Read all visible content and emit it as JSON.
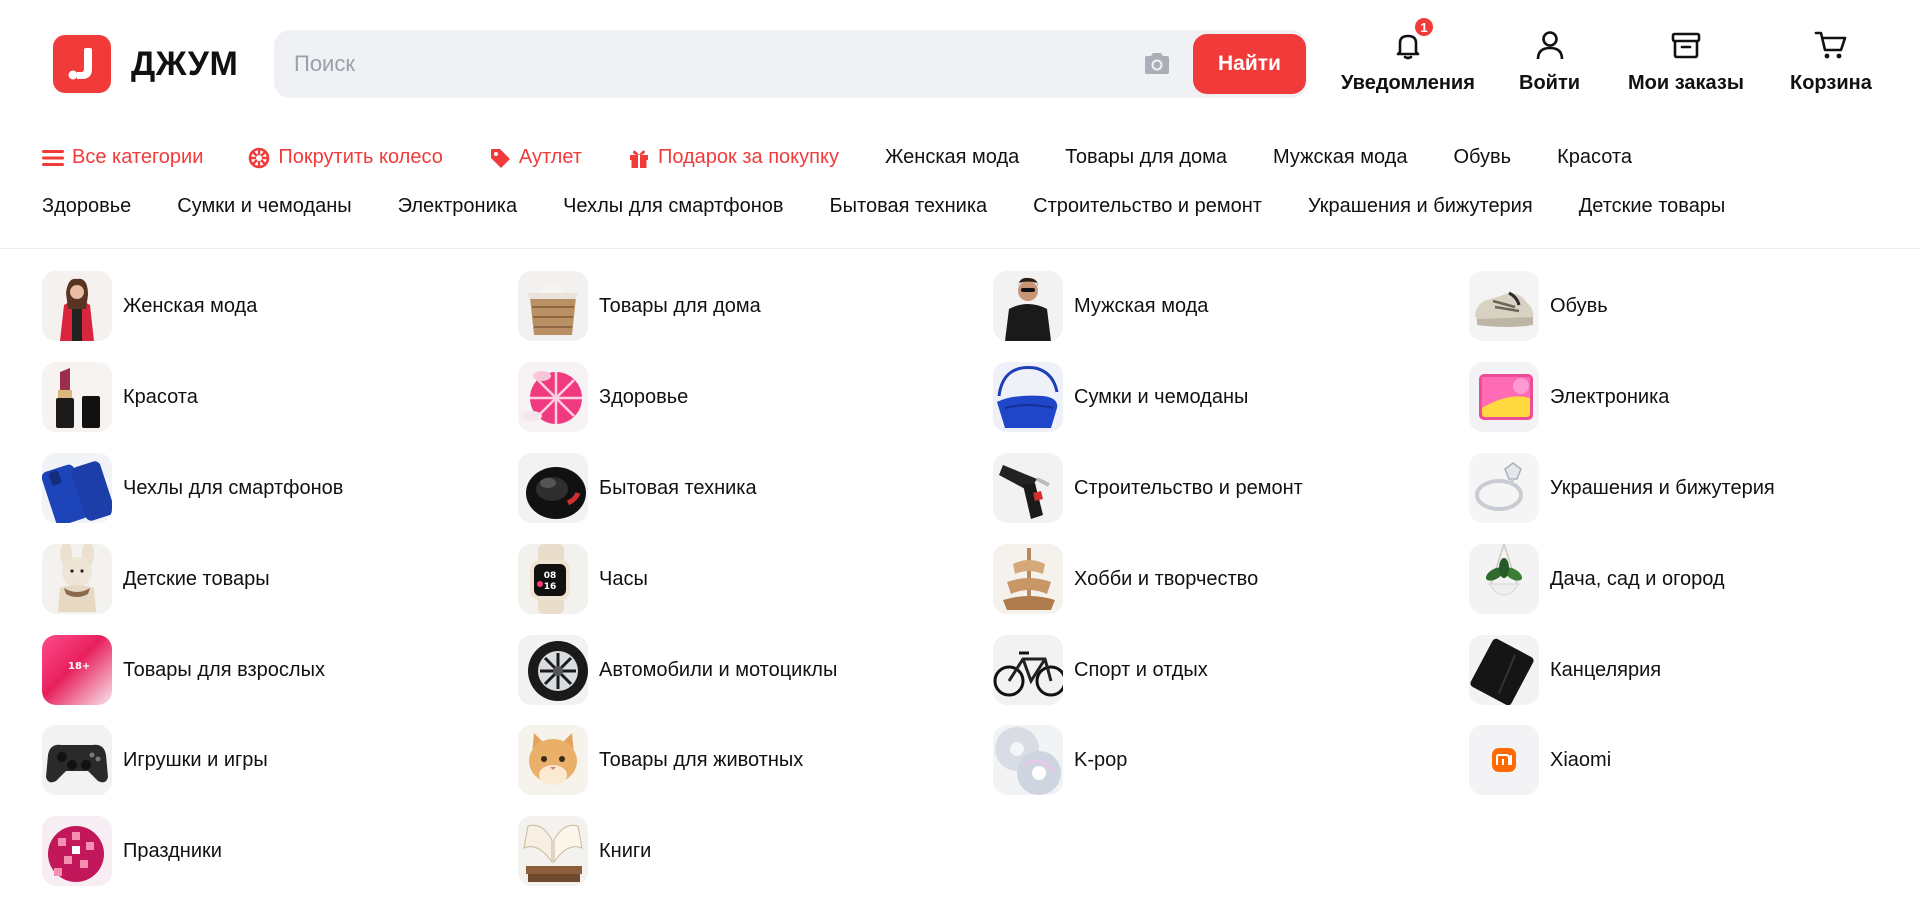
{
  "brand": {
    "name": "ДЖУМ",
    "accent": "#f13b3b"
  },
  "search": {
    "placeholder": "Поиск",
    "value": "",
    "button_label": "Найти"
  },
  "header_actions": {
    "notifications": {
      "label": "Уведомления",
      "badge": "1",
      "icon": "bell-icon"
    },
    "login": {
      "label": "Войти",
      "icon": "user-icon"
    },
    "orders": {
      "label": "Мои заказы",
      "icon": "archive-box-icon"
    },
    "cart": {
      "label": "Корзина",
      "icon": "cart-icon"
    }
  },
  "nav": {
    "all_categories": "Все категории",
    "spin_wheel": "Покрутить колесо",
    "outlet": "Аутлет",
    "gift": "Подарок за покупку",
    "row1": [
      "Женская мода",
      "Товары для дома",
      "Мужская мода",
      "Обувь",
      "Красота"
    ],
    "row2": [
      "Здоровье",
      "Сумки и чемоданы",
      "Электроника",
      "Чехлы для смартфонов",
      "Бытовая техника",
      "Строительство и ремонт",
      "Украшения и бижутерия",
      "Детские товары"
    ]
  },
  "categories": [
    {
      "label": "Женская мода",
      "icon": "woman-fashion-thumb"
    },
    {
      "label": "Товары для дома",
      "icon": "laundry-basket-thumb"
    },
    {
      "label": "Мужская мода",
      "icon": "man-fashion-thumb"
    },
    {
      "label": "Обувь",
      "icon": "sneaker-thumb"
    },
    {
      "label": "Красота",
      "icon": "lipstick-thumb"
    },
    {
      "label": "Здоровье",
      "icon": "pill-box-thumb"
    },
    {
      "label": "Сумки и чемоданы",
      "icon": "handbag-thumb"
    },
    {
      "label": "Электроника",
      "icon": "tablet-thumb"
    },
    {
      "label": "Чехлы для смартфонов",
      "icon": "phone-case-thumb"
    },
    {
      "label": "Бытовая техника",
      "icon": "appliance-thumb"
    },
    {
      "label": "Строительство и ремонт",
      "icon": "glue-gun-thumb"
    },
    {
      "label": "Украшения и бижутерия",
      "icon": "ring-thumb"
    },
    {
      "label": "Детские товары",
      "icon": "plush-toy-thumb"
    },
    {
      "label": "Часы",
      "icon": "smartwatch-thumb"
    },
    {
      "label": "Хобби и творчество",
      "icon": "wooden-model-thumb"
    },
    {
      "label": "Дача, сад и огород",
      "icon": "hanging-plant-thumb"
    },
    {
      "label": "Товары для взрослых",
      "icon": "adult-18-thumb",
      "thumb_text": "18+"
    },
    {
      "label": "Автомобили и мотоциклы",
      "icon": "wheel-rim-thumb"
    },
    {
      "label": "Спорт и отдых",
      "icon": "bicycle-thumb"
    },
    {
      "label": "Канцелярия",
      "icon": "notebook-thumb"
    },
    {
      "label": "Игрушки и игры",
      "icon": "gamepad-thumb"
    },
    {
      "label": "Товары для животных",
      "icon": "kitten-thumb"
    },
    {
      "label": "K-pop",
      "icon": "cd-discs-thumb"
    },
    {
      "label": "Xiaomi",
      "icon": "xiaomi-logo-thumb"
    },
    {
      "label": "Праздники",
      "icon": "disco-ball-thumb"
    },
    {
      "label": "Книги",
      "icon": "open-book-thumb"
    }
  ]
}
